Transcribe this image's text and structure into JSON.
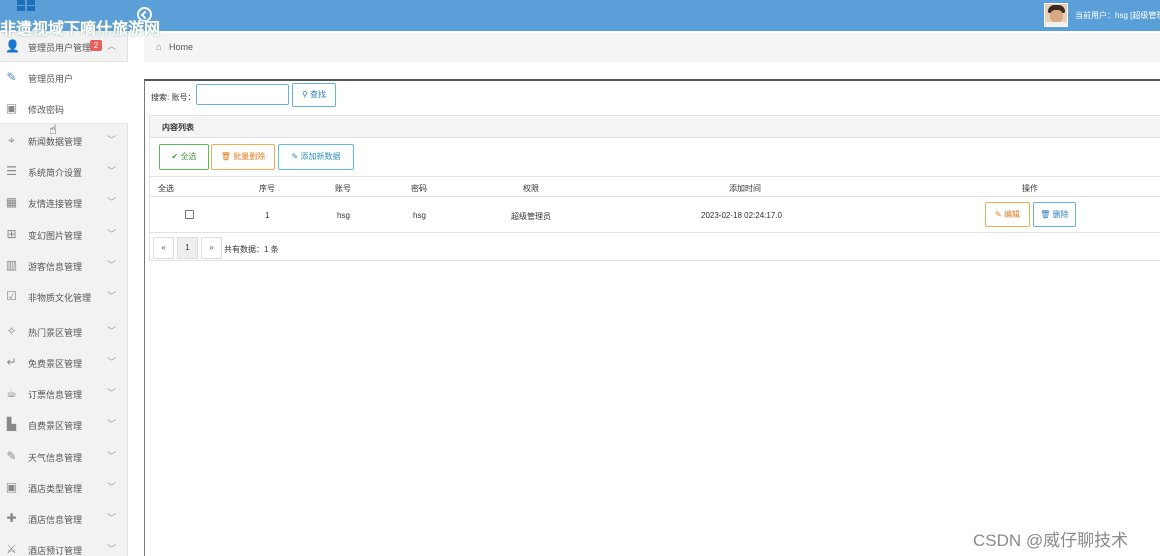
{
  "overlay_text": "非遗视域下嘀什旅游网",
  "header": {
    "user_info": "当前用户：hsg [超级管理"
  },
  "breadcrumb": {
    "home": "Home"
  },
  "sidebar": {
    "items": [
      {
        "label": "管理员用户管理",
        "icon": "user-icon",
        "badge": "2"
      },
      {
        "label": "管理员用户",
        "icon": "pencil-icon"
      },
      {
        "label": "修改密码",
        "icon": "image-icon"
      },
      {
        "label": "新闻数据管理",
        "icon": "crosshair-icon"
      },
      {
        "label": "系统简介设置",
        "icon": "list-icon"
      },
      {
        "label": "友情连接管理",
        "icon": "table-icon"
      },
      {
        "label": "变幻图片管理",
        "icon": "gift-icon"
      },
      {
        "label": "游客信息管理",
        "icon": "map-icon"
      },
      {
        "label": "非物质文化管理",
        "icon": "check-square-icon"
      },
      {
        "label": "热门景区管理",
        "icon": "magic-icon"
      },
      {
        "label": "免费景区管理",
        "icon": "reply-icon"
      },
      {
        "label": "订票信息管理",
        "icon": "coffee-icon"
      },
      {
        "label": "自费景区管理",
        "icon": "truck-icon"
      },
      {
        "label": "天气信息管理",
        "icon": "pencil-icon"
      },
      {
        "label": "酒店类型管理",
        "icon": "image-icon"
      },
      {
        "label": "酒店信息管理",
        "icon": "plus-icon"
      },
      {
        "label": "酒店预订管理",
        "icon": "cutlery-icon"
      }
    ]
  },
  "search": {
    "label": "搜索: 账号：",
    "value": "",
    "button": "查找"
  },
  "panel": {
    "title": "内容列表",
    "btn_select_all": "全选",
    "btn_batch_delete": "批量删除",
    "btn_add": "添加新数据"
  },
  "table": {
    "headers": [
      "全选",
      "序号",
      "账号",
      "密码",
      "权限",
      "添加时间",
      "操作"
    ],
    "rows": [
      {
        "index": "1",
        "account": "hsg",
        "password": "hsg",
        "role": "超级管理员",
        "time": "2023-02-18 02:24:17.0",
        "edit": "编辑",
        "delete": "删除"
      }
    ]
  },
  "pager": {
    "prev": "«",
    "page": "1",
    "next": "»",
    "total": "共有数据：1 条"
  },
  "watermark": "CSDN @威仔聊技术",
  "colors": {
    "topbar": "#5b9fd8",
    "primary": "#2d7cbf",
    "success": "#5cb85c",
    "warning": "#f0ad4e",
    "danger_badge": "#e95f5f"
  }
}
